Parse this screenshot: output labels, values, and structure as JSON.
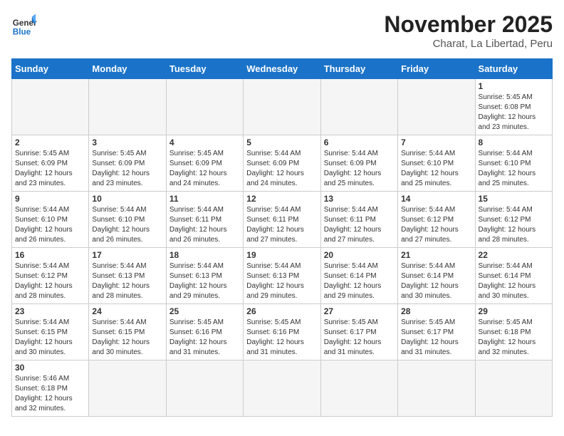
{
  "logo": {
    "general": "General",
    "blue": "Blue"
  },
  "title": "November 2025",
  "location": "Charat, La Libertad, Peru",
  "weekdays": [
    "Sunday",
    "Monday",
    "Tuesday",
    "Wednesday",
    "Thursday",
    "Friday",
    "Saturday"
  ],
  "weeks": [
    [
      {
        "day": "",
        "info": ""
      },
      {
        "day": "",
        "info": ""
      },
      {
        "day": "",
        "info": ""
      },
      {
        "day": "",
        "info": ""
      },
      {
        "day": "",
        "info": ""
      },
      {
        "day": "",
        "info": ""
      },
      {
        "day": "1",
        "info": "Sunrise: 5:45 AM\nSunset: 6:08 PM\nDaylight: 12 hours and 23 minutes."
      }
    ],
    [
      {
        "day": "2",
        "info": "Sunrise: 5:45 AM\nSunset: 6:09 PM\nDaylight: 12 hours and 23 minutes."
      },
      {
        "day": "3",
        "info": "Sunrise: 5:45 AM\nSunset: 6:09 PM\nDaylight: 12 hours and 23 minutes."
      },
      {
        "day": "4",
        "info": "Sunrise: 5:45 AM\nSunset: 6:09 PM\nDaylight: 12 hours and 24 minutes."
      },
      {
        "day": "5",
        "info": "Sunrise: 5:44 AM\nSunset: 6:09 PM\nDaylight: 12 hours and 24 minutes."
      },
      {
        "day": "6",
        "info": "Sunrise: 5:44 AM\nSunset: 6:09 PM\nDaylight: 12 hours and 25 minutes."
      },
      {
        "day": "7",
        "info": "Sunrise: 5:44 AM\nSunset: 6:10 PM\nDaylight: 12 hours and 25 minutes."
      },
      {
        "day": "8",
        "info": "Sunrise: 5:44 AM\nSunset: 6:10 PM\nDaylight: 12 hours and 25 minutes."
      }
    ],
    [
      {
        "day": "9",
        "info": "Sunrise: 5:44 AM\nSunset: 6:10 PM\nDaylight: 12 hours and 26 minutes."
      },
      {
        "day": "10",
        "info": "Sunrise: 5:44 AM\nSunset: 6:10 PM\nDaylight: 12 hours and 26 minutes."
      },
      {
        "day": "11",
        "info": "Sunrise: 5:44 AM\nSunset: 6:11 PM\nDaylight: 12 hours and 26 minutes."
      },
      {
        "day": "12",
        "info": "Sunrise: 5:44 AM\nSunset: 6:11 PM\nDaylight: 12 hours and 27 minutes."
      },
      {
        "day": "13",
        "info": "Sunrise: 5:44 AM\nSunset: 6:11 PM\nDaylight: 12 hours and 27 minutes."
      },
      {
        "day": "14",
        "info": "Sunrise: 5:44 AM\nSunset: 6:12 PM\nDaylight: 12 hours and 27 minutes."
      },
      {
        "day": "15",
        "info": "Sunrise: 5:44 AM\nSunset: 6:12 PM\nDaylight: 12 hours and 28 minutes."
      }
    ],
    [
      {
        "day": "16",
        "info": "Sunrise: 5:44 AM\nSunset: 6:12 PM\nDaylight: 12 hours and 28 minutes."
      },
      {
        "day": "17",
        "info": "Sunrise: 5:44 AM\nSunset: 6:13 PM\nDaylight: 12 hours and 28 minutes."
      },
      {
        "day": "18",
        "info": "Sunrise: 5:44 AM\nSunset: 6:13 PM\nDaylight: 12 hours and 29 minutes."
      },
      {
        "day": "19",
        "info": "Sunrise: 5:44 AM\nSunset: 6:13 PM\nDaylight: 12 hours and 29 minutes."
      },
      {
        "day": "20",
        "info": "Sunrise: 5:44 AM\nSunset: 6:14 PM\nDaylight: 12 hours and 29 minutes."
      },
      {
        "day": "21",
        "info": "Sunrise: 5:44 AM\nSunset: 6:14 PM\nDaylight: 12 hours and 30 minutes."
      },
      {
        "day": "22",
        "info": "Sunrise: 5:44 AM\nSunset: 6:14 PM\nDaylight: 12 hours and 30 minutes."
      }
    ],
    [
      {
        "day": "23",
        "info": "Sunrise: 5:44 AM\nSunset: 6:15 PM\nDaylight: 12 hours and 30 minutes."
      },
      {
        "day": "24",
        "info": "Sunrise: 5:44 AM\nSunset: 6:15 PM\nDaylight: 12 hours and 30 minutes."
      },
      {
        "day": "25",
        "info": "Sunrise: 5:45 AM\nSunset: 6:16 PM\nDaylight: 12 hours and 31 minutes."
      },
      {
        "day": "26",
        "info": "Sunrise: 5:45 AM\nSunset: 6:16 PM\nDaylight: 12 hours and 31 minutes."
      },
      {
        "day": "27",
        "info": "Sunrise: 5:45 AM\nSunset: 6:17 PM\nDaylight: 12 hours and 31 minutes."
      },
      {
        "day": "28",
        "info": "Sunrise: 5:45 AM\nSunset: 6:17 PM\nDaylight: 12 hours and 31 minutes."
      },
      {
        "day": "29",
        "info": "Sunrise: 5:45 AM\nSunset: 6:18 PM\nDaylight: 12 hours and 32 minutes."
      }
    ],
    [
      {
        "day": "30",
        "info": "Sunrise: 5:46 AM\nSunset: 6:18 PM\nDaylight: 12 hours and 32 minutes."
      },
      {
        "day": "",
        "info": ""
      },
      {
        "day": "",
        "info": ""
      },
      {
        "day": "",
        "info": ""
      },
      {
        "day": "",
        "info": ""
      },
      {
        "day": "",
        "info": ""
      },
      {
        "day": "",
        "info": ""
      }
    ]
  ]
}
